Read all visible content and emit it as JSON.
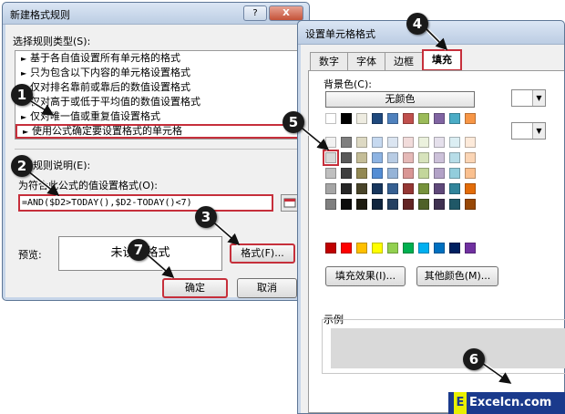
{
  "dialog1": {
    "title": "新建格式规则",
    "help_btn": "?",
    "close_btn": "X",
    "rule_type_label": "选择规则类型(S):",
    "rule_types": [
      "基于各自值设置所有单元格的格式",
      "只为包含以下内容的单元格设置格式",
      "仅对排名靠前或靠后的数值设置格式",
      "仅对高于或低于平均值的数值设置格式",
      "仅对唯一值或重复值设置格式",
      "使用公式确定要设置格式的单元格"
    ],
    "edit_desc_label": "编辑规则说明(E):",
    "formula_label": "为符合此公式的值设置格式(O):",
    "formula_value": "=AND($D2>TODAY(),$D2-TODAY()<7)",
    "preview_label": "预览:",
    "preview_text": "未设定格式",
    "format_btn": "格式(F)...",
    "ok_btn": "确定",
    "cancel_btn": "取消"
  },
  "dialog2": {
    "title": "设置单元格格式",
    "tabs": [
      "数字",
      "字体",
      "边框",
      "填充"
    ],
    "bg_color_label": "背景色(C):",
    "no_color_btn": "无颜色",
    "fill_effects_btn": "填充效果(I)...",
    "more_colors_btn": "其他颜色(M)...",
    "sample_label": "示例"
  },
  "palette": {
    "theme_rows": [
      [
        "#ffffff",
        "#000000",
        "#eeece1",
        "#1f497d",
        "#4f81bd",
        "#c0504d",
        "#9bbb59",
        "#8064a2",
        "#4bacc6",
        "#f79646"
      ],
      [
        "#f2f2f2",
        "#7f7f7f",
        "#ddd9c3",
        "#c6d9f0",
        "#dbe5f1",
        "#f2dcdb",
        "#ebf1dd",
        "#e5e0ec",
        "#dbeef3",
        "#fdeada"
      ],
      [
        "#d8d8d8",
        "#595959",
        "#c4bd97",
        "#8db3e2",
        "#b8cce4",
        "#e5b9b7",
        "#d7e3bc",
        "#ccc1d9",
        "#b7dde8",
        "#fbd5b5"
      ],
      [
        "#bfbfbf",
        "#3f3f3f",
        "#938953",
        "#548dd4",
        "#95b3d7",
        "#d99694",
        "#c3d69b",
        "#b2a2c7",
        "#92cddc",
        "#fac08f"
      ],
      [
        "#a5a5a5",
        "#262626",
        "#494429",
        "#17365d",
        "#366092",
        "#953734",
        "#76923c",
        "#5f497a",
        "#31859b",
        "#e36c09"
      ],
      [
        "#7f7f7f",
        "#0c0c0c",
        "#1d1b10",
        "#0f243e",
        "#244061",
        "#632423",
        "#4f6128",
        "#3f3151",
        "#205867",
        "#974806"
      ]
    ],
    "standard_row": [
      "#c00000",
      "#ff0000",
      "#ffc000",
      "#ffff00",
      "#92d050",
      "#00b050",
      "#00b0f0",
      "#0070c0",
      "#002060",
      "#7030a0"
    ],
    "accent_color": "#c62f3b"
  },
  "callouts": [
    "1",
    "2",
    "3",
    "4",
    "5",
    "6",
    "7"
  ],
  "watermark": {
    "logo": "E",
    "text": "Excelcn.com"
  }
}
